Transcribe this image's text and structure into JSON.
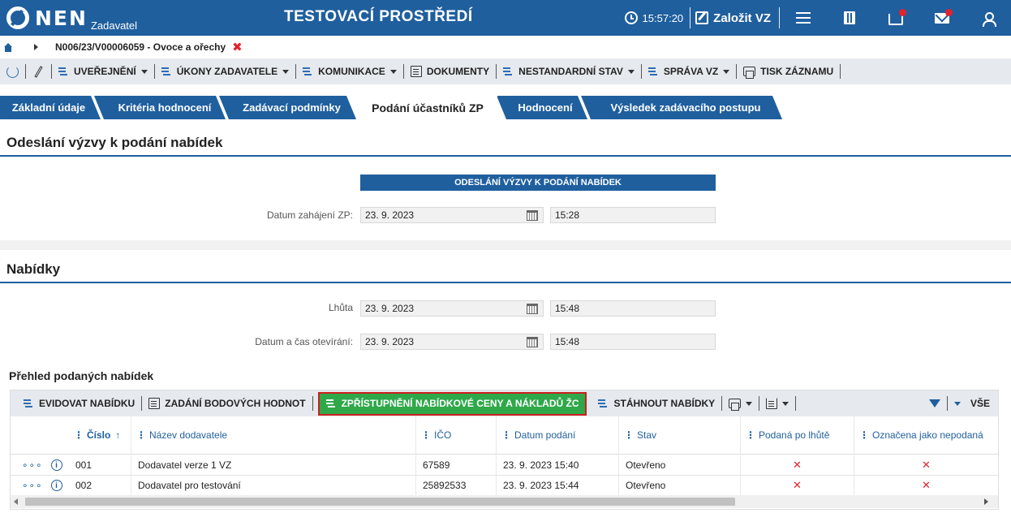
{
  "header": {
    "logo_text": "NEN",
    "logo_sub": "Zadavatel",
    "environment_title": "TESTOVACÍ PROSTŘEDÍ",
    "clock": "15:57:20",
    "create_label": "Založit VZ",
    "icons": [
      "menu-icon",
      "calculator-icon",
      "inbox-icon",
      "mail-icon",
      "user-icon"
    ],
    "accent": "#1f5f9e",
    "notification_color": "#e3222c"
  },
  "breadcrumb": {
    "text": "N006/23/V00006059 - Ovoce a ořechy",
    "close_glyph": "✖"
  },
  "toolbar": {
    "items": [
      {
        "label": "UVEŘEJNĚNÍ",
        "icon": "lines-icon",
        "dropdown": true
      },
      {
        "label": "ÚKONY ZADAVATELE",
        "icon": "lines-icon",
        "dropdown": true
      },
      {
        "label": "KOMUNIKACE",
        "icon": "lines-icon",
        "dropdown": true
      },
      {
        "label": "DOKUMENTY",
        "icon": "document-icon",
        "dropdown": false
      },
      {
        "label": "NESTANDARDNÍ STAV",
        "icon": "lines-icon",
        "dropdown": true
      },
      {
        "label": "SPRÁVA VZ",
        "icon": "lines-icon",
        "dropdown": true
      },
      {
        "label": "TISK ZÁZNAMU",
        "icon": "print-icon",
        "dropdown": false
      }
    ]
  },
  "tabs": [
    {
      "label": "Základní údaje",
      "active": false
    },
    {
      "label": "Kritéria hodnocení",
      "active": false
    },
    {
      "label": "Zadávací podmínky",
      "active": false
    },
    {
      "label": "Podání účastníků ZP",
      "active": true
    },
    {
      "label": "Hodnocení",
      "active": false
    },
    {
      "label": "Výsledek zadávacího postupu",
      "active": false
    }
  ],
  "section1": {
    "title": "Odeslání výzvy k podání nabídek",
    "form_header": "ODESLÁNÍ VÝZVY K PODÁNÍ NABÍDEK",
    "start_label": "Datum zahájení ZP:",
    "start_date": "23. 9. 2023",
    "start_time": "15:28"
  },
  "section2": {
    "title": "Nabídky",
    "deadline_label": "Lhůta",
    "deadline_date": "23. 9. 2023",
    "deadline_time": "15:48",
    "opening_label": "Datum a čas otevírání:",
    "opening_date": "23. 9. 2023",
    "opening_time": "15:48"
  },
  "offers": {
    "title": "Přehled podaných nabídek",
    "toolbar": {
      "register": "EVIDOVAT NABÍDKU",
      "points": "ZADÁNÍ BODOVÝCH HODNOT",
      "disclose": "ZPŘÍSTUPNĚNÍ NABÍDKOVÉ CENY A NÁKLADŮ ŽC",
      "download": "STÁHNOUT NABÍDKY",
      "filter_all": "VŠE"
    },
    "columns": [
      "Číslo",
      "Název dodavatele",
      "IČO",
      "Datum podání",
      "Stav",
      "Podaná po lhůtě",
      "Označena jako nepodaná"
    ],
    "sort_glyph": "↑",
    "rows": [
      {
        "num": "001",
        "supplier": "Dodavatel verze 1 VZ",
        "ico": "67589",
        "date": "23. 9. 2023 15:40",
        "state": "Otevřeno",
        "late": "✕",
        "unsubmitted": "✕"
      },
      {
        "num": "002",
        "supplier": "Dodavatel pro testování",
        "ico": "25892533",
        "date": "23. 9. 2023 15:44",
        "state": "Otevřeno",
        "late": "✕",
        "unsubmitted": "✕"
      }
    ]
  }
}
